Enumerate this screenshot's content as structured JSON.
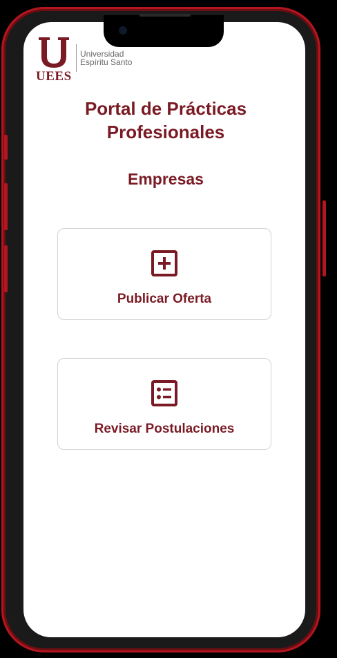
{
  "brand": {
    "logo_letters": "UEES",
    "logo_text_line1": "Universidad",
    "logo_text_line2": "Espíritu Santo",
    "primary_color": "#7a1a24",
    "frame_color": "#b3161f"
  },
  "header": {
    "title_line1": "Portal de Prácticas",
    "title_line2": "Profesionales",
    "section": "Empresas"
  },
  "actions": [
    {
      "label": "Publicar Oferta",
      "icon": "plus-square-icon"
    },
    {
      "label": "Revisar Postulaciones",
      "icon": "list-icon"
    }
  ]
}
